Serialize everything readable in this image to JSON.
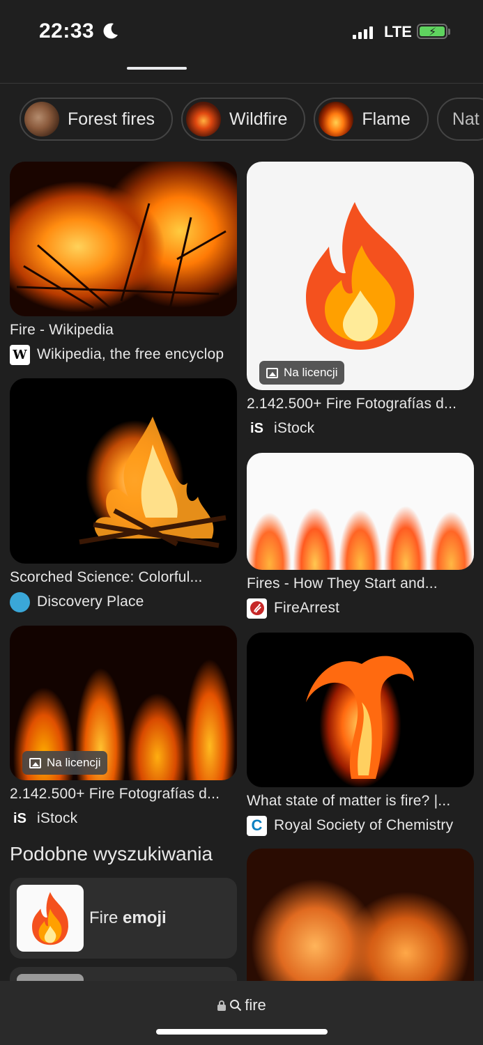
{
  "status_bar": {
    "time": "22:33",
    "network": "LTE",
    "icons": [
      "moon-icon",
      "signal-icon",
      "battery-charging-icon"
    ]
  },
  "chips": [
    {
      "label": "Forest fires",
      "thumb": "forest-fire-thumbnail"
    },
    {
      "label": "Wildfire",
      "thumb": "wildfire-thumbnail"
    },
    {
      "label": "Flame",
      "thumb": "flame-thumbnail"
    },
    {
      "label": "Nat",
      "thumb": ""
    }
  ],
  "results_left": [
    {
      "title": "Fire - Wikipedia",
      "source": "Wikipedia, the free encyclop",
      "source_icon": "W",
      "image": "forest-fire-photo"
    },
    {
      "title": "Scorched Science: Colorful...",
      "source": "Discovery Place",
      "source_icon": "",
      "image": "bonfire-photo"
    },
    {
      "title": "2.142.500+ Fire Fotografías d...",
      "source": "iStock",
      "source_icon": "iS",
      "image": "flames-photo",
      "badge": "Na licencji"
    }
  ],
  "results_right": [
    {
      "title": "2.142.500+ Fire Fotografías d...",
      "source": "iStock",
      "source_icon": "iS",
      "image": "fire-emoji-illustration",
      "badge": "Na licencji"
    },
    {
      "title": "Fires - How They Start and...",
      "source": "FireArrest",
      "source_icon": "",
      "image": "flames-on-white"
    },
    {
      "title": "What state of matter is fire? |...",
      "source": "Royal Society of Chemistry",
      "source_icon": "C",
      "image": "twisting-flame-photo"
    },
    {
      "title": "",
      "source": "",
      "image": "warm-flames-photo"
    }
  ],
  "related": {
    "title": "Podobne wyszukiwania",
    "items": [
      {
        "prefix": "Fire ",
        "bold": "emoji"
      }
    ]
  },
  "bottom_bar": {
    "url": "fire"
  },
  "colors": {
    "background": "#1f1f1f",
    "text": "#e8e8e8",
    "chip_border": "#444444",
    "battery_green": "#5fd35f"
  }
}
